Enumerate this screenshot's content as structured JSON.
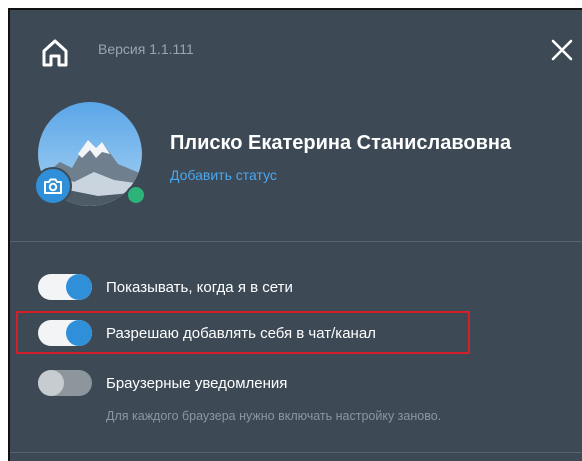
{
  "header": {
    "version_text": "Версия 1.1.111",
    "home_icon": "home-icon",
    "close_icon": "close-icon"
  },
  "profile": {
    "name": "Плиско Екатерина Станиславовна",
    "add_status_label": "Добавить статус",
    "online": true,
    "camera_icon": "camera-icon"
  },
  "settings": {
    "items": [
      {
        "label": "Показывать, когда я в сети",
        "enabled": true
      },
      {
        "label": "Разрешаю добавлять себя в чат/канал",
        "enabled": true,
        "highlighted": true
      },
      {
        "label": "Браузерные уведомления",
        "enabled": false
      }
    ],
    "browser_hint": "Для каждого браузера нужно включать настройку заново."
  },
  "colors": {
    "panel_bg": "#3d4a55",
    "accent": "#2f8fd8",
    "online": "#2db37a",
    "highlight": "#d21f2a"
  }
}
